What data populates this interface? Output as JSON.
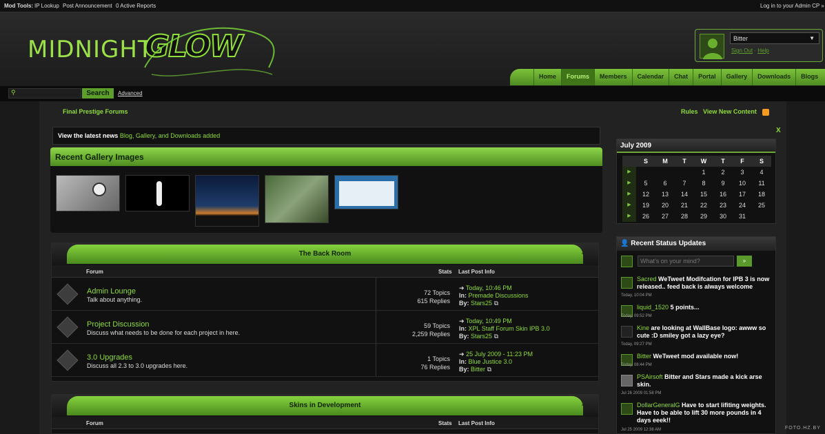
{
  "topbar": {
    "mod_tools": "Mod Tools:",
    "ip_lookup": "IP Lookup",
    "post_announcement": "Post Announcement",
    "active_reports": "0 Active Reports",
    "admin_cp": "Log in to your Admin CP »"
  },
  "logo": {
    "part1": "MIDNIGHT",
    "part2": "GLOW"
  },
  "user": {
    "name": "Bitter",
    "sign_out": "Sign Out",
    "help": "Help"
  },
  "nav": [
    "Home",
    "Forums",
    "Members",
    "Calendar",
    "Chat",
    "Portal",
    "Gallery",
    "Downloads",
    "Blogs"
  ],
  "nav_active": "Forums",
  "search": {
    "button": "Search",
    "advanced": "Advanced"
  },
  "breadcrumb": "Final Prestige Forums",
  "toplinks": {
    "rules": "Rules",
    "new_content": "View New Content"
  },
  "news": {
    "label": "View the latest news",
    "text": "Blog, Gallery, and Downloads added"
  },
  "gallery": {
    "title": "Recent Gallery Images"
  },
  "categories": [
    {
      "title": "The Back Room",
      "min": "–",
      "col_forum": "Forum",
      "col_stats": "Stats",
      "col_last": "Last Post Info",
      "forums": [
        {
          "name": "Admin Lounge",
          "desc": "Talk about anything.",
          "topics": "72 Topics",
          "replies": "615 Replies",
          "date": "Today, 10:46 PM",
          "in": "Premade Discussions",
          "by": "Stars25"
        },
        {
          "name": "Project Discussion",
          "desc": "Discuss what needs to be done for each project in here.",
          "topics": "59 Topics",
          "replies": "2,259 Replies",
          "date": "Today, 10:49 PM",
          "in": "XPL Staff Forum Skin IPB 3.0",
          "by": "Stars25"
        },
        {
          "name": "3.0 Upgrades",
          "desc": "Discuss all 2.3 to 3.0 upgrades here.",
          "topics": "1 Topics",
          "replies": "76 Replies",
          "date": "25 July 2009 - 11:23 PM",
          "in": "Blue Justice 3.0",
          "by": "Bitter"
        }
      ]
    },
    {
      "title": "Skins in Development",
      "min": "–",
      "col_forum": "Forum",
      "col_stats": "Stats",
      "col_last": "Last Post Info",
      "forums": []
    }
  ],
  "labels": {
    "in": "In:",
    "by": "By:",
    "arrow": "➔",
    "ext": "⧉"
  },
  "calendar": {
    "title": "July 2009",
    "days": [
      "S",
      "M",
      "T",
      "W",
      "T",
      "F",
      "S"
    ],
    "weeks": [
      [
        "",
        "",
        "",
        "1",
        "2",
        "3",
        "4"
      ],
      [
        "5",
        "6",
        "7",
        "8",
        "9",
        "10",
        "11"
      ],
      [
        "12",
        "13",
        "14",
        "15",
        "16",
        "17",
        "18"
      ],
      [
        "19",
        "20",
        "21",
        "22",
        "23",
        "24",
        "25"
      ],
      [
        "26",
        "27",
        "28",
        "29",
        "30",
        "31",
        ""
      ]
    ],
    "arrow": "▶"
  },
  "status": {
    "title": "Recent Status Updates",
    "placeholder": "What's on your mind?",
    "submit": "»",
    "items": [
      {
        "name": "Sacred",
        "text": "WeTweet Modifcation for IPB 3 is now released.. feed back is always welcome",
        "date": "Today, 10:04 PM"
      },
      {
        "name": "liquid_1520",
        "text": "5 points...",
        "date": "Today, 09:52 PM"
      },
      {
        "name": "Kine",
        "text": "are looking at WallBase logo: awww so cute :D smiley got a lazy eye?",
        "date": "Today, 09:27 PM"
      },
      {
        "name": "Bitter",
        "text": "WeTweet mod available now!",
        "date": "Today, 08:44 PM"
      },
      {
        "name": "PSAirsoft",
        "text": "Bitter and Stars made a kick arse skin.",
        "date": "Jul 26 2009 01:58 PM"
      },
      {
        "name": "DollarGeneralG",
        "text": "Have to start lifiting weights. Have to be able to lift 30 more pounds in 4 days eeek!!",
        "date": "Jul 25 2009 12:38 AM"
      }
    ]
  },
  "close": "X",
  "watermark": "FOTO.HZ.BY",
  "colors": {
    "accent": "#8fdc3a",
    "bg": "#1a1a1a"
  }
}
